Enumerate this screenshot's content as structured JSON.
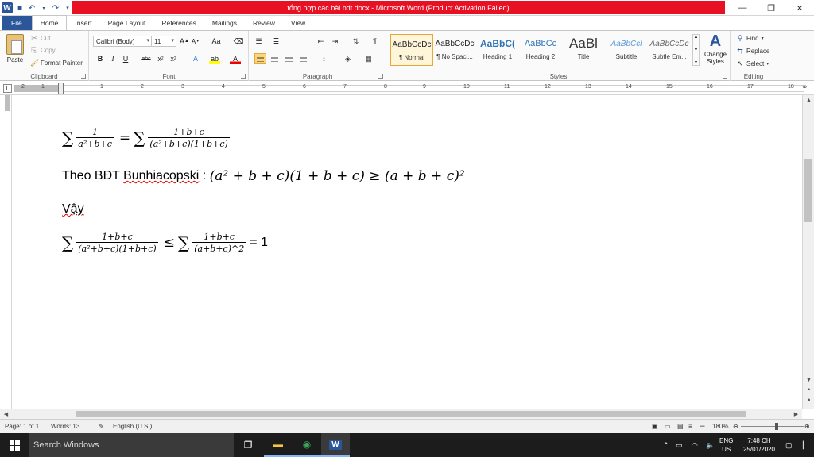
{
  "title": "tổng hợp các bài bđt.docx - Microsoft Word (Product Activation Failed)",
  "qat": {
    "icons": [
      "word-logo-icon",
      "save-icon",
      "undo-icon",
      "redo-icon",
      "customize-icon"
    ]
  },
  "tabs": [
    "File",
    "Home",
    "Insert",
    "Page Layout",
    "References",
    "Mailings",
    "Review",
    "View"
  ],
  "ribbon": {
    "clipboard": {
      "paste": "Paste",
      "cut": "Cut",
      "copy": "Copy",
      "format_painter": "Format Painter",
      "label": "Clipboard"
    },
    "font": {
      "family": "Calibri (Body)",
      "size": "11",
      "label": "Font"
    },
    "paragraph": {
      "label": "Paragraph"
    },
    "styles": {
      "items": [
        {
          "sample": "AaBbCcDc",
          "name": "¶ Normal"
        },
        {
          "sample": "AaBbCcDc",
          "name": "¶ No Spaci..."
        },
        {
          "sample": "AaBbC(",
          "name": "Heading 1"
        },
        {
          "sample": "AaBbCc",
          "name": "Heading 2"
        },
        {
          "sample": "AaBl",
          "name": "Title"
        },
        {
          "sample": "AaBbCcl",
          "name": "Subtitle"
        },
        {
          "sample": "AaBbCcDc",
          "name": "Subtle Em..."
        }
      ],
      "change_styles": "Change Styles",
      "label": "Styles"
    },
    "editing": {
      "find": "Find",
      "replace": "Replace",
      "select": "Select",
      "label": "Editing"
    }
  },
  "ruler": {
    "numbers": [
      "2",
      "1",
      "1",
      "2",
      "3",
      "4",
      "5",
      "6",
      "7",
      "8",
      "9",
      "10",
      "11",
      "12",
      "13",
      "14",
      "15",
      "16",
      "17",
      "18"
    ]
  },
  "document": {
    "line1": {
      "num_a": "1",
      "den_a": "a²+b+c",
      "num_b": "1+b+c",
      "den_b": "(a²+b+c)(1+b+c)"
    },
    "line2": {
      "prefix": "Theo BĐT ",
      "word": "Bunhiacopski",
      "sep": " : ",
      "math": "(a² + b + c)(1 + b + c) ≥ (a + b + c)²"
    },
    "line3": {
      "word": "Vậy"
    },
    "line4": {
      "num_a": "1+b+c",
      "den_a": "(a²+b+c)(1+b+c)",
      "num_b": "1+b+c",
      "den_b": "(a+b+c)^2",
      "result": "= 1"
    }
  },
  "status": {
    "page": "Page: 1 of 1",
    "words": "Words: 13",
    "language": "English (U.S.)",
    "zoom": "180%"
  },
  "taskbar": {
    "search": "Search Windows",
    "lang1": "ENG",
    "lang2": "US",
    "time": "7:48 CH",
    "date": "25/01/2020"
  },
  "colors": {
    "title_red": "#e81123",
    "file_tab": "#2b579a",
    "taskbar": "#1c1c1c"
  }
}
